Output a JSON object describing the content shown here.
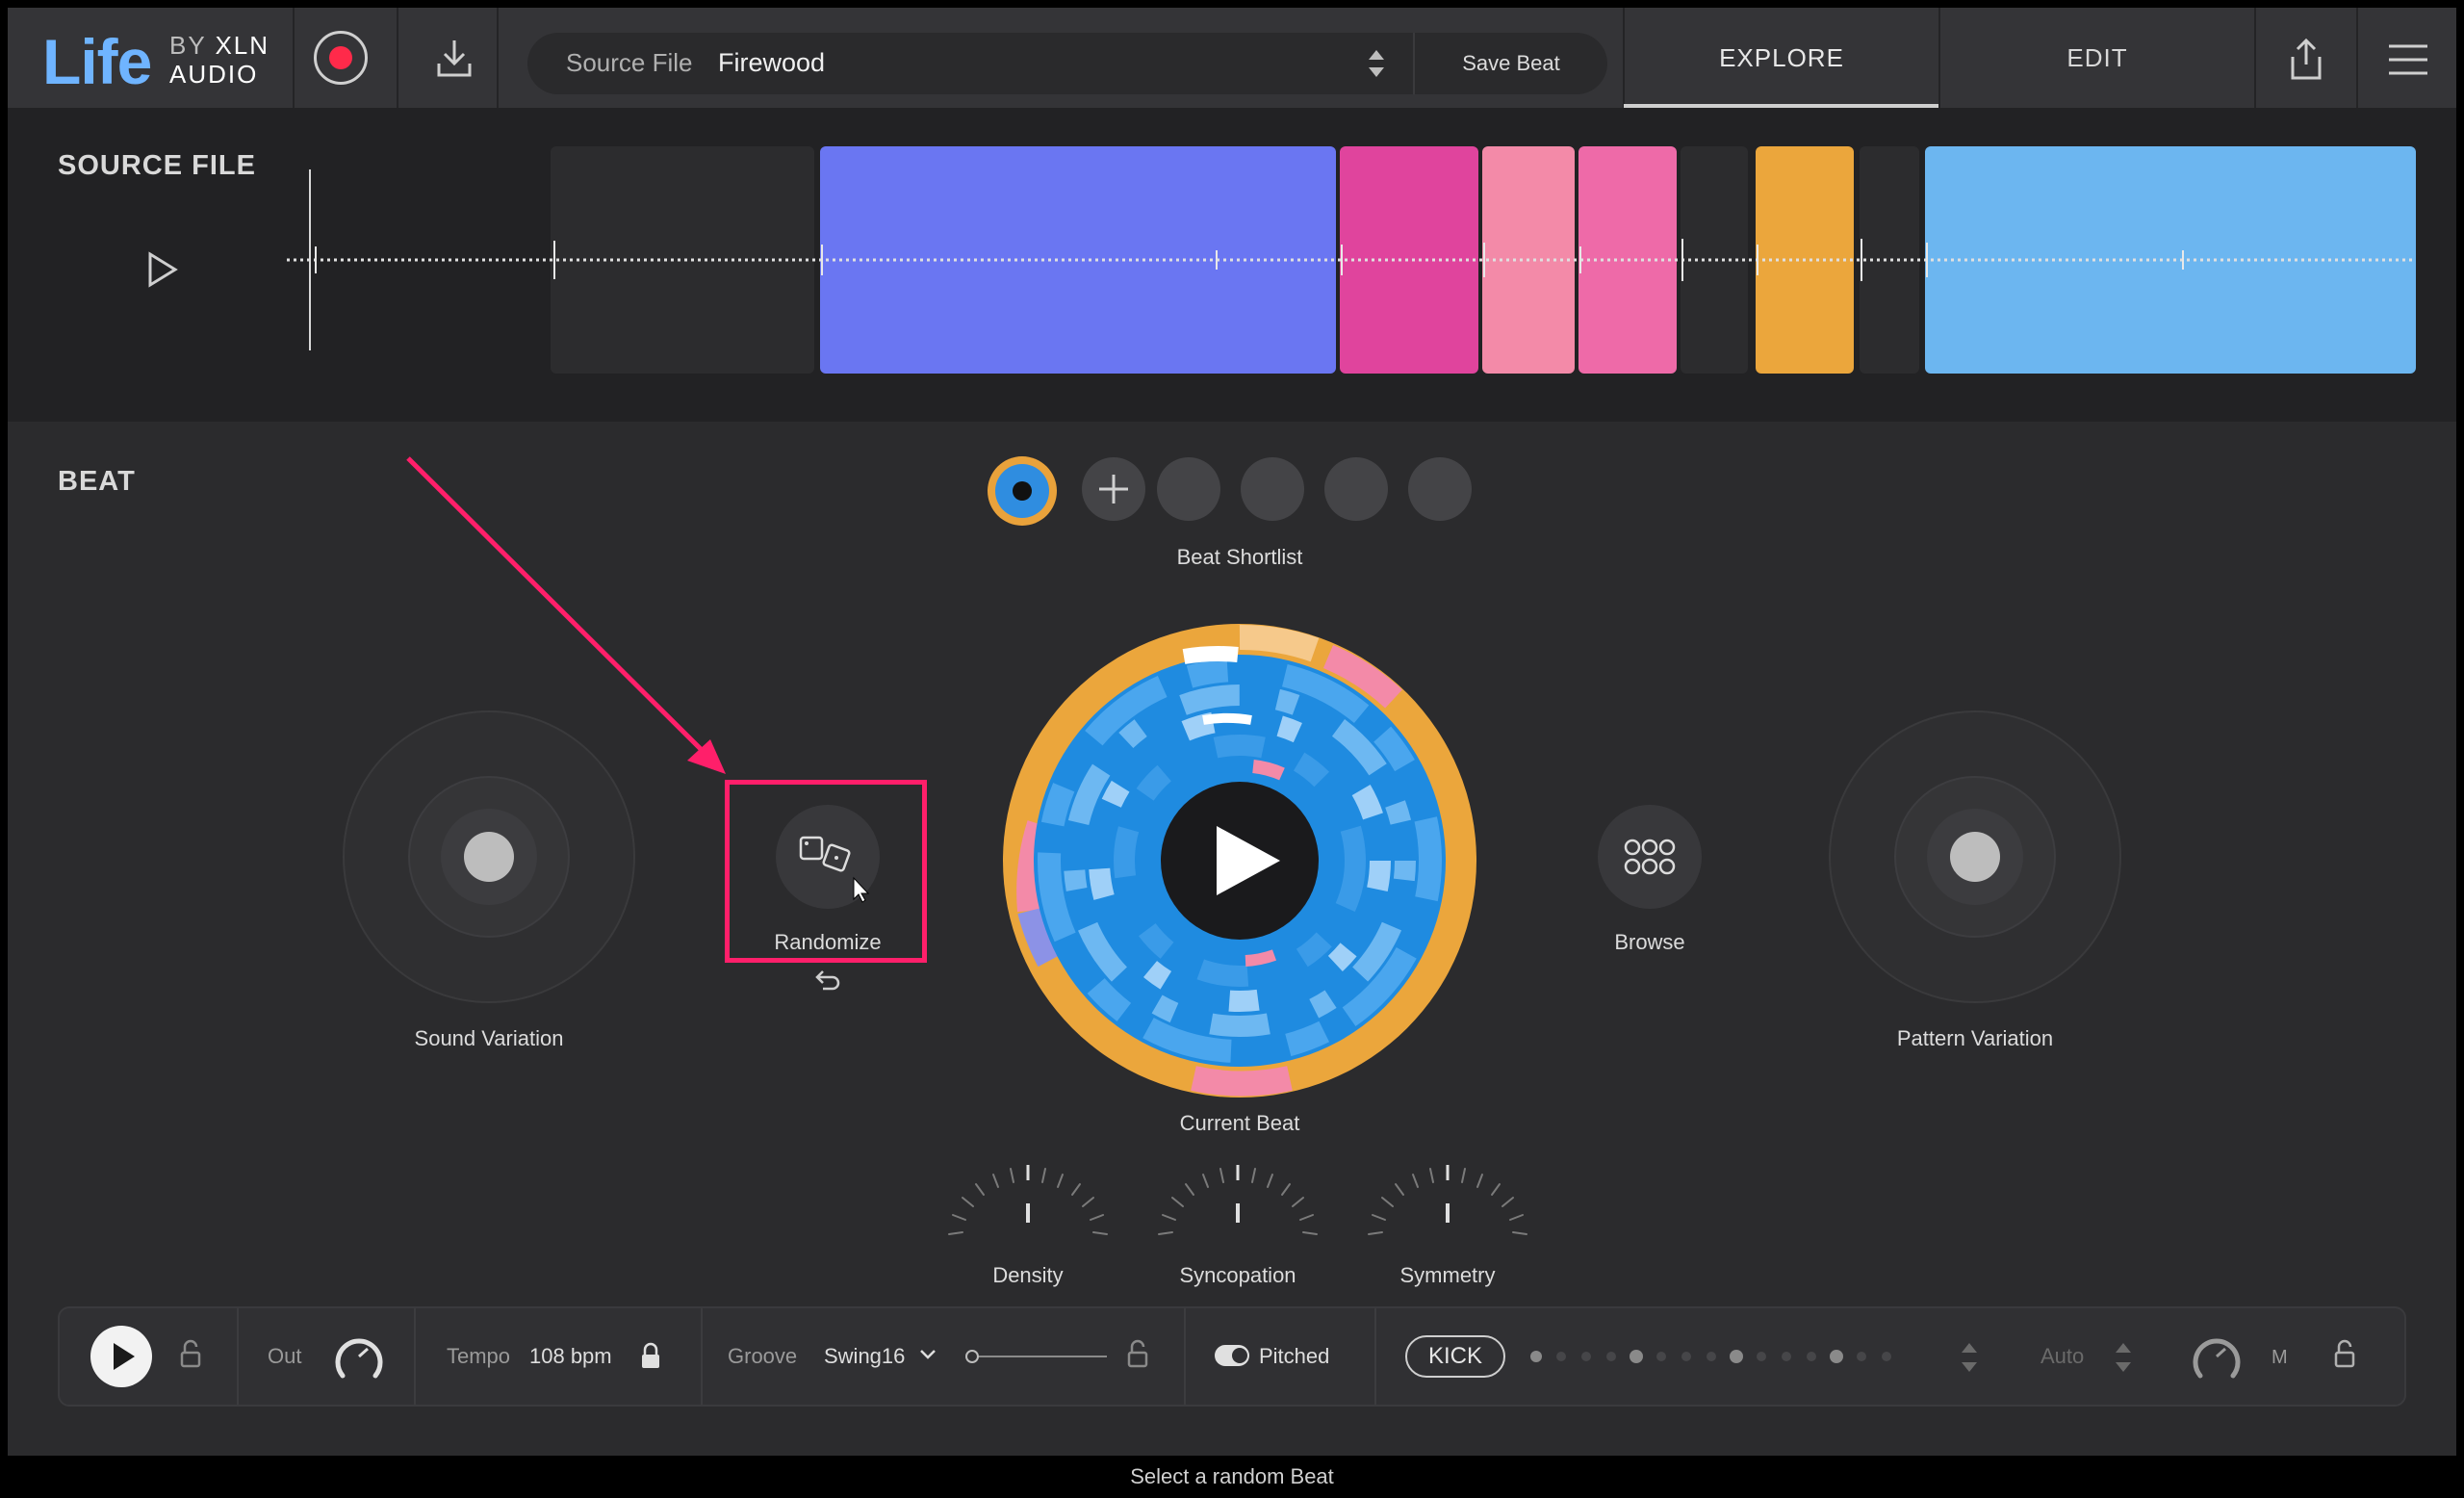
{
  "app": {
    "logo_life": "Life",
    "logo_by": "BY",
    "logo_xln": "XLN",
    "logo_audio": "AUDIO"
  },
  "topbar": {
    "source_file_label": "Source File",
    "source_file_value": "Firewood",
    "save_beat_label": "Save Beat",
    "tabs": [
      {
        "label": "EXPLORE",
        "active": true
      },
      {
        "label": "EDIT",
        "active": false
      }
    ],
    "icons": [
      "record-icon",
      "download-icon",
      "share-icon",
      "menu-icon"
    ]
  },
  "source_section": {
    "title": "SOURCE FILE",
    "regions_colors": [
      "#6a76f2",
      "#e0449d",
      "#f38aa8",
      "#ee6aa8",
      "#eba63c",
      "#6cb6f0"
    ]
  },
  "beat_section": {
    "title": "BEAT",
    "shortlist_label": "Beat Shortlist",
    "sound_variation_label": "Sound Variation",
    "randomize_label": "Randomize",
    "current_beat_label": "Current Beat",
    "browse_label": "Browse",
    "pattern_variation_label": "Pattern Variation",
    "knobs": [
      {
        "label": "Density"
      },
      {
        "label": "Syncopation"
      },
      {
        "label": "Symmetry"
      }
    ],
    "accent_color": "#ff1f6a"
  },
  "bottom_bar": {
    "out_label": "Out",
    "tempo_label": "Tempo",
    "tempo_value": "108 bpm",
    "groove_label": "Groove",
    "groove_value": "Swing16",
    "pitched_label": "Pitched",
    "pitched_on": true,
    "kick_label": "KICK",
    "auto_label": "Auto",
    "m_label": "M"
  },
  "status_bar": {
    "text": "Select a random Beat"
  }
}
